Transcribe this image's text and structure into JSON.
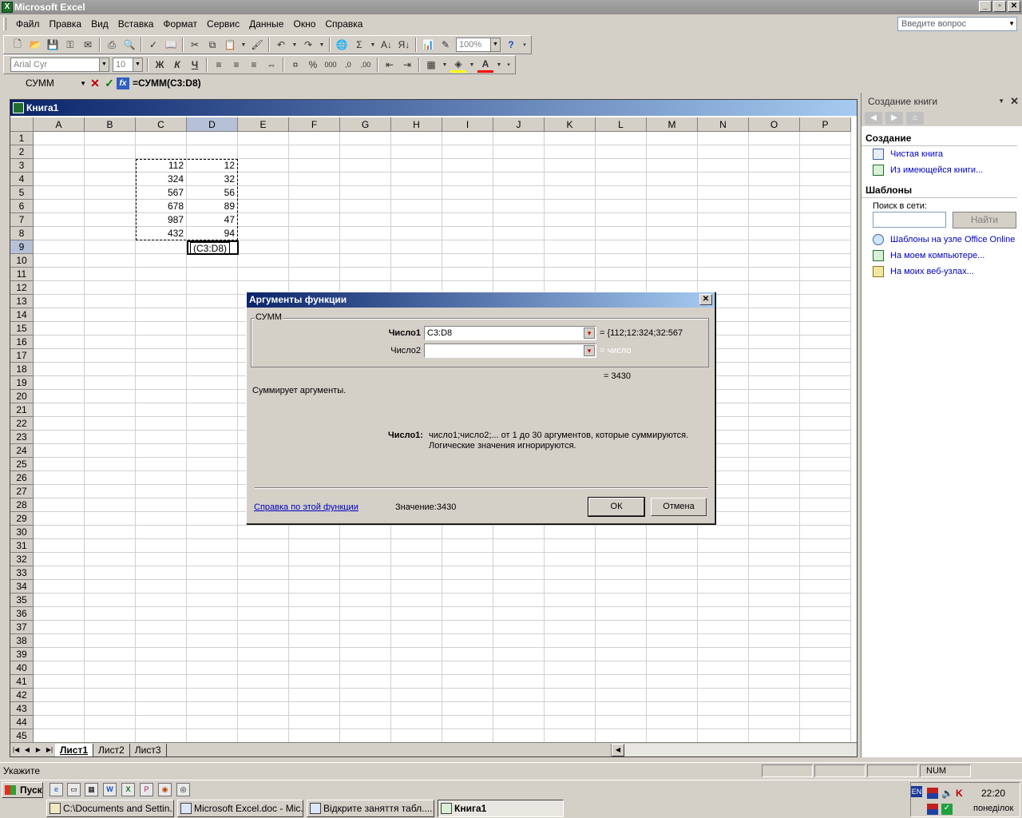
{
  "app": {
    "title": "Microsoft Excel",
    "icon": "excel-icon"
  },
  "menu": {
    "items": [
      "Файл",
      "Правка",
      "Вид",
      "Вставка",
      "Формат",
      "Сервис",
      "Данные",
      "Окно",
      "Справка"
    ],
    "ask_placeholder": "Введите вопрос"
  },
  "toolbar": {
    "zoom": "100%",
    "font": "Arial Cyr",
    "font_size": "10",
    "bold": "Ж",
    "italic": "К",
    "underline": "Ч"
  },
  "formula_bar": {
    "name_box": "СУММ",
    "formula": "=СУММ(C3:D8)"
  },
  "workbook": {
    "title": "Книга1",
    "columns": [
      "A",
      "B",
      "C",
      "D",
      "E",
      "F",
      "G",
      "H",
      "I",
      "J",
      "K",
      "L",
      "M",
      "N",
      "O",
      "P"
    ],
    "rows": [
      "1",
      "2",
      "3",
      "4",
      "5",
      "6",
      "7",
      "8",
      "9",
      "10",
      "11",
      "12",
      "13",
      "14",
      "15",
      "16",
      "17",
      "18",
      "19",
      "20",
      "21",
      "22",
      "23",
      "24",
      "25",
      "26",
      "27",
      "28",
      "29",
      "30",
      "31",
      "32",
      "33",
      "34",
      "35",
      "36",
      "37",
      "38",
      "39",
      "40",
      "41",
      "42",
      "43",
      "44",
      "45"
    ],
    "data": {
      "C": [
        "",
        "",
        "112",
        "324",
        "567",
        "678",
        "987",
        "432"
      ],
      "D": [
        "",
        "",
        "12",
        "32",
        "56",
        "89",
        "47",
        "94"
      ]
    },
    "active_cell_text": "(C3:D8)",
    "sheets": [
      "Лист1",
      "Лист2",
      "Лист3"
    ]
  },
  "dialog": {
    "title": "Аргументы функции",
    "function_name": "СУММ",
    "arg1_label": "Число1",
    "arg1_value": "C3:D8",
    "arg1_result": "= {112;12:324;32:567",
    "arg2_label": "Число2",
    "arg2_value": "",
    "arg2_result": "= число",
    "total": "= 3430",
    "description": "Суммирует аргументы.",
    "arg_help_label": "Число1:",
    "arg_help_line1": "число1;число2;... от 1 до 30 аргументов, которые суммируются.",
    "arg_help_line2": "Логические значения игнорируются.",
    "help_link": "Справка по этой функции",
    "value_label": "Значение:",
    "value": "3430",
    "ok": "ОК",
    "cancel": "Отмена"
  },
  "taskpane": {
    "title": "Создание книги",
    "section_create": "Создание",
    "link_blank": "Чистая книга",
    "link_existing": "Из имеющейся книги...",
    "section_templates": "Шаблоны",
    "search_label": "Поиск в сети:",
    "search_button": "Найти",
    "link_online": "Шаблоны на узле Office Online",
    "link_computer": "На моем компьютере...",
    "link_web": "На моих веб-узлах..."
  },
  "status": {
    "text": "Укажите",
    "num": "NUM"
  },
  "taskbar": {
    "start": "Пуск",
    "tasks": [
      "C:\\Documents and Settin...",
      "Microsoft Excel.doc - Mic...",
      "Відкрите заняття табл....",
      "Книга1"
    ],
    "lang": "EN",
    "time": "22:20",
    "day": "понеділок"
  }
}
